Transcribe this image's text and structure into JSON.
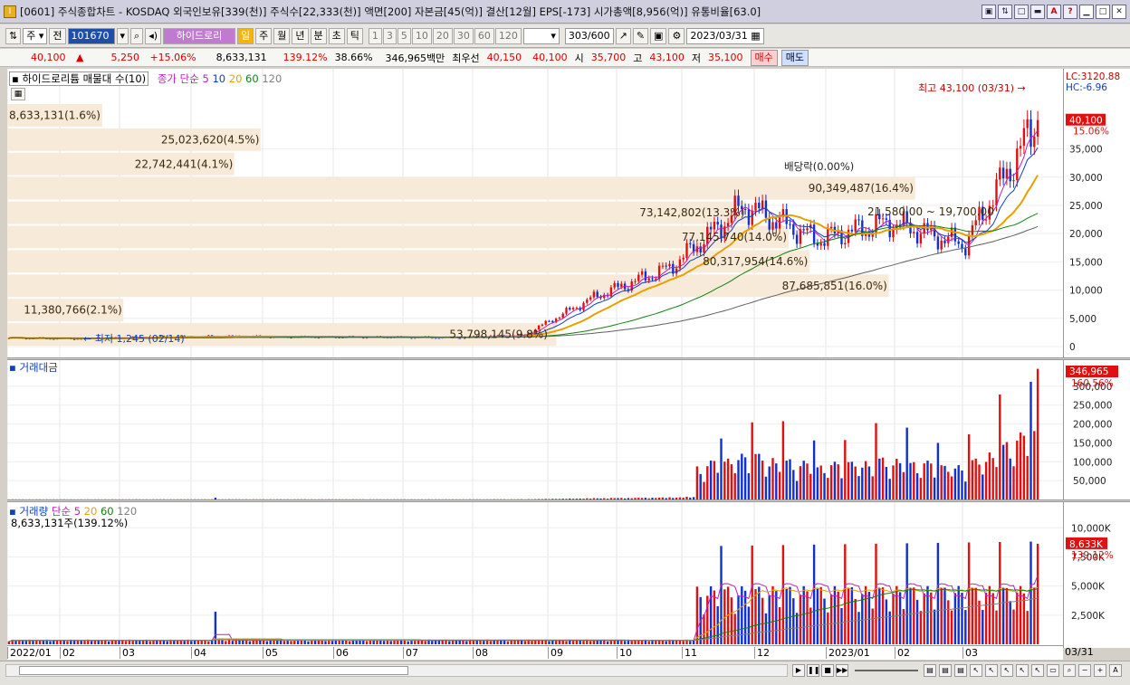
{
  "window": {
    "title": "[0601] 주식종합차트 - KOSDAQ 외국인보유[339(천)] 주식수[22,333(천)] 액면[200] 자본금[45(억)] 결산[12월] EPS[-173] 시가총액[8,956(억)] 유통비율[63.0]",
    "buttons": [
      "▣",
      "⇅",
      "□",
      "▬",
      "A",
      "?",
      "▁",
      "□",
      "✕"
    ]
  },
  "toolbar": {
    "period_select": "주",
    "prev_label": "전",
    "code": "101670",
    "stock_name": "하이드로리",
    "tf_day": "일",
    "tf_week": "주",
    "tf_month": "월",
    "tf_year": "년",
    "tf_min": "분",
    "tf_sec": "초",
    "tf_tick": "틱",
    "intervals": [
      "1",
      "3",
      "5",
      "10",
      "20",
      "30",
      "60",
      "120"
    ],
    "count": "303",
    "count_total": "/600",
    "date": "2023/03/31"
  },
  "quote": {
    "price": "40,100",
    "up_arrow": "▲",
    "change": "5,250",
    "change_pct": "+15.06%",
    "volume": "8,633,131",
    "vol_ratio": "139.12%",
    "turnover": "38.66%",
    "amount": "346,965백만",
    "best_ask_label": "최우선",
    "best_ask": "40,150",
    "best_bid": "40,100",
    "open_label": "시",
    "open": "35,700",
    "high_label": "고",
    "high": "43,100",
    "low_label": "저",
    "low": "35,100",
    "buy": "매수",
    "sell": "매도"
  },
  "price_pane": {
    "label": "하이드로리튬 매물대 수(10)",
    "ma_label": "종가 단순",
    "ma_periods": [
      "5",
      "10",
      "20",
      "60",
      "120"
    ],
    "ma_colors": [
      "#c020c0",
      "#1040c0",
      "#e8a000",
      "#108010",
      "#606060"
    ],
    "high_note": "최고 43,100 (03/31) →",
    "low_note": "← 최저 1,245 (02/14)",
    "dividend_note": "배당락(0.00%)",
    "range_note": "21,580.00 ~ 19,700.00",
    "lc": "LC:3120.88",
    "hc": "HC:-6.96",
    "price_tag": "40,100",
    "price_pct": "15.06%",
    "y_ticks": [
      "35,000",
      "30,000",
      "25,000",
      "20,000",
      "15,000",
      "10,000",
      "5,000",
      "0"
    ],
    "volume_profile": [
      {
        "label": "8,633,131(1.6%)",
        "row": 0,
        "width": 0.09
      },
      {
        "label": "25,023,620(4.5%)",
        "row": 1,
        "width": 0.24
      },
      {
        "label": "22,742,441(4.1%)",
        "row": 2,
        "width": 0.215
      },
      {
        "label": "90,349,487(16.4%)",
        "row": 3,
        "width": 0.86
      },
      {
        "label": "73,142,802(13.3%)",
        "row": 4,
        "width": 0.7
      },
      {
        "label": "77,145,740(14.0%)",
        "row": 5,
        "width": 0.74
      },
      {
        "label": "80,317,954(14.6%)",
        "row": 6,
        "width": 0.76
      },
      {
        "label": "87,685,851(16.0%)",
        "row": 7,
        "width": 0.835
      },
      {
        "label": "11,380,766(2.1%)",
        "row": 8,
        "width": 0.11
      },
      {
        "label": "53,798,145(9.8%)",
        "row": 9,
        "width": 0.52
      }
    ]
  },
  "amount_pane": {
    "label": "거래대금",
    "tag": "346,965",
    "tag_pct": "160.56%",
    "y_ticks": [
      "300,000",
      "250,000",
      "200,000",
      "150,000",
      "100,000",
      "50,000"
    ]
  },
  "volume_pane": {
    "label": "거래량",
    "ma_label": "단순",
    "ma_periods": [
      "5",
      "20",
      "60",
      "120"
    ],
    "sub": "8,633,131주(139.12%)",
    "tag": "8,633K",
    "tag_pct": "139.12%",
    "y_ticks": [
      "10,000K",
      "7,500K",
      "5,000K",
      "2,500K"
    ]
  },
  "x_axis": {
    "labels": [
      "2022/01",
      "02",
      "03",
      "04",
      "05",
      "06",
      "07",
      "08",
      "09",
      "10",
      "11",
      "12",
      "2023/01",
      "02",
      "03"
    ],
    "right_label": "03/31"
  },
  "chart_data": {
    "type": "candlestick",
    "title": "하이드로리튬",
    "x": [
      "2022/01",
      "02",
      "03",
      "04",
      "05",
      "06",
      "07",
      "08",
      "09",
      "10",
      "11",
      "12",
      "2023/01",
      "02",
      "03"
    ],
    "close": [
      1500,
      1400,
      1700,
      1800,
      1700,
      1650,
      1600,
      2000,
      9000,
      14000,
      25000,
      19000,
      22000,
      18000,
      40100
    ],
    "ylim": [
      0,
      43100
    ],
    "high": 43100,
    "low": 1245
  }
}
